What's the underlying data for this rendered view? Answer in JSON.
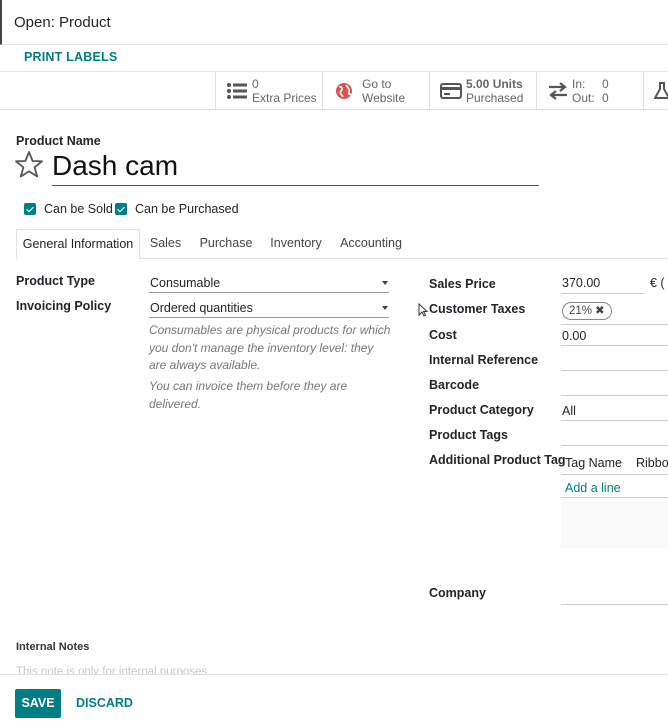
{
  "dialog": {
    "title": "Open: Product"
  },
  "actions": {
    "print_labels": "PRINT LABELS"
  },
  "smart_buttons": {
    "extra_prices": {
      "count": "0",
      "label": "Extra Prices",
      "icon": "list-icon"
    },
    "website": {
      "line1": "Go to",
      "line2": "Website",
      "icon": "globe-icon",
      "icon_color": "#d9534f"
    },
    "purchased": {
      "line1": "5.00 Units",
      "line2": "Purchased",
      "icon": "credit-card-icon"
    },
    "in_out": {
      "in_label": "In:",
      "in_value": "0",
      "out_label": "Out:",
      "out_value": "0",
      "icon": "exchange-icon"
    }
  },
  "product": {
    "name_label": "Product Name",
    "name": "Dash cam",
    "favorite_icon": "star-icon",
    "can_be_sold": {
      "label": "Can be Sold",
      "checked": true
    },
    "can_be_purchased": {
      "label": "Can be Purchased",
      "checked": true
    }
  },
  "tabs": [
    "General Information",
    "Sales",
    "Purchase",
    "Inventory",
    "Accounting"
  ],
  "active_tab": "General Information",
  "left_fields": {
    "product_type": {
      "label": "Product Type",
      "value": "Consumable"
    },
    "invoicing_policy": {
      "label": "Invoicing Policy",
      "value": "Ordered quantities"
    },
    "help1": "Consumables are physical products for which you don't manage the inventory level: they are always available.",
    "help2": "You can invoice them before they are delivered."
  },
  "right_fields": {
    "sales_price": {
      "label": "Sales Price",
      "value": "370.00",
      "currency": "€ ("
    },
    "customer_taxes": {
      "label": "Customer Taxes",
      "tag": "21%"
    },
    "cost": {
      "label": "Cost",
      "value": "0.00"
    },
    "internal_reference": {
      "label": "Internal Reference",
      "value": ""
    },
    "barcode": {
      "label": "Barcode",
      "value": ""
    },
    "product_category": {
      "label": "Product Category",
      "value": "All"
    },
    "product_tags": {
      "label": "Product Tags",
      "value": ""
    },
    "additional_product_tag": {
      "label": "Additional Product Tag",
      "columns": [
        "Tag Name",
        "Ribbon"
      ],
      "add_line": "Add a line"
    },
    "company": {
      "label": "Company",
      "value": ""
    }
  },
  "notes": {
    "label": "Internal Notes",
    "placeholder": "This note is only for internal purposes."
  },
  "footer": {
    "save": "SAVE",
    "discard": "DISCARD"
  },
  "colors": {
    "primary": "#017e84",
    "text": "#212529",
    "muted": "#777777"
  }
}
